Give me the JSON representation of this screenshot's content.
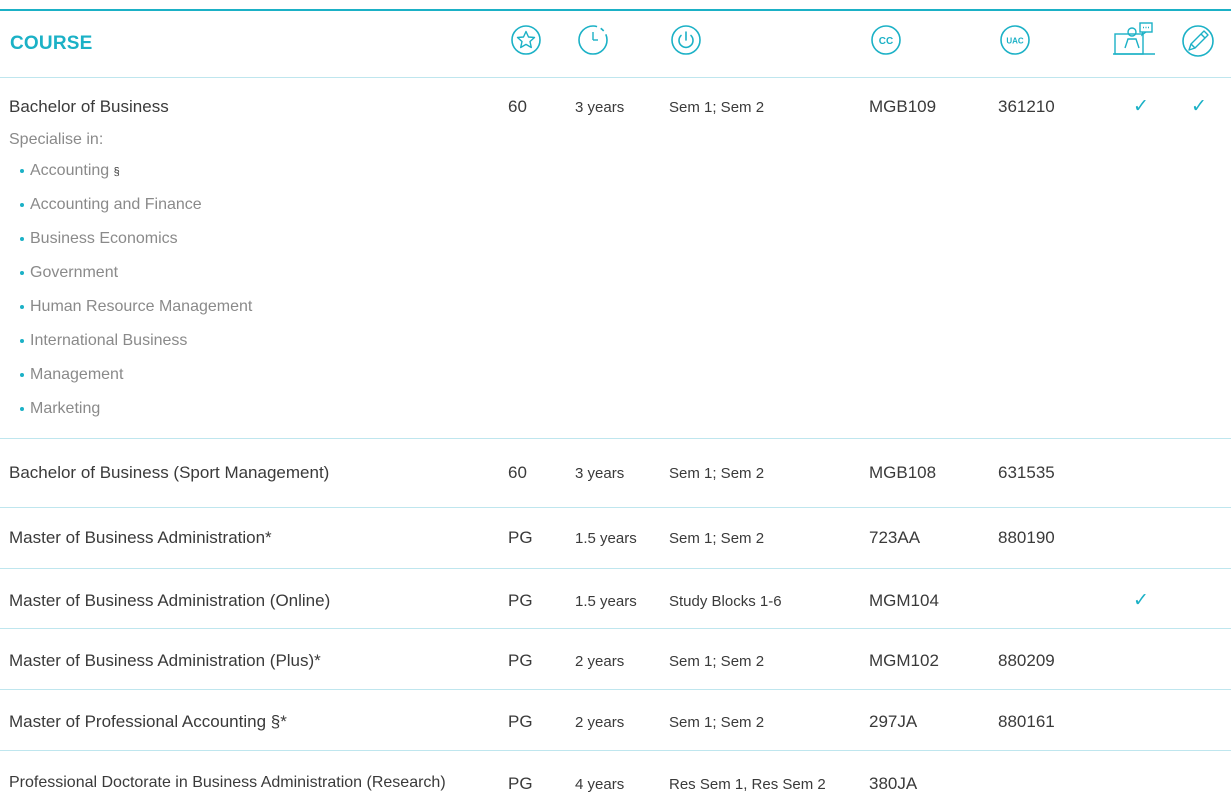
{
  "header": {
    "course": "COURSE",
    "icons": [
      "star-icon",
      "clock-icon",
      "power-icon",
      "cc-badge-icon",
      "uac-badge-icon",
      "presenter-icon",
      "pencil-icon"
    ],
    "cc_badge": "CC",
    "uac_badge": "UAC"
  },
  "colors": {
    "accent": "#1bb1c6",
    "rule": "#bfe6ee",
    "text": "#3a3a3a",
    "muted": "#8a8a8a"
  },
  "specialise_label": "Specialise in:",
  "specialisations": [
    "Accounting",
    "Accounting and Finance",
    "Business Economics",
    "Government",
    "Human Resource Management",
    "International Business",
    "Management",
    "Marketing"
  ],
  "accounting_marker": "§",
  "check": "✓",
  "rows": [
    {
      "name": "Bachelor of Business",
      "cp": "60",
      "duration": "3 years",
      "intake": "Sem 1; Sem 2",
      "cc": "MGB109",
      "uac": "361210",
      "col8": true,
      "col9": true
    },
    {
      "name": "Bachelor of Business (Sport Management)",
      "cp": "60",
      "duration": "3 years",
      "intake": "Sem 1; Sem 2",
      "cc": "MGB108",
      "uac": "631535",
      "col8": false,
      "col9": false
    },
    {
      "name": "Master of Business Administration*",
      "cp": "PG",
      "duration": "1.5 years",
      "intake": "Sem 1; Sem 2",
      "cc": "723AA",
      "uac": "880190",
      "col8": false,
      "col9": false
    },
    {
      "name": "Master of Business Administration (Online)",
      "cp": "PG",
      "duration": "1.5 years",
      "intake": "Study Blocks 1-6",
      "cc": "MGM104",
      "uac": "",
      "col8": true,
      "col9": false
    },
    {
      "name": "Master of Business Administration (Plus)*",
      "cp": "PG",
      "duration": "2 years",
      "intake": "Sem 1; Sem 2",
      "cc": "MGM102",
      "uac": "880209",
      "col8": false,
      "col9": false
    },
    {
      "name": "Master of Professional Accounting §*",
      "cp": "PG",
      "duration": "2 years",
      "intake": "Sem 1; Sem 2",
      "cc": "297JA",
      "uac": "880161",
      "col8": false,
      "col9": false
    },
    {
      "name": "Professional Doctorate in Business Administration (Research)",
      "cp": "PG",
      "duration": "4 years",
      "intake": "Res Sem 1, Res Sem 2",
      "cc": "380JA",
      "uac": "",
      "col8": false,
      "col9": false
    }
  ]
}
